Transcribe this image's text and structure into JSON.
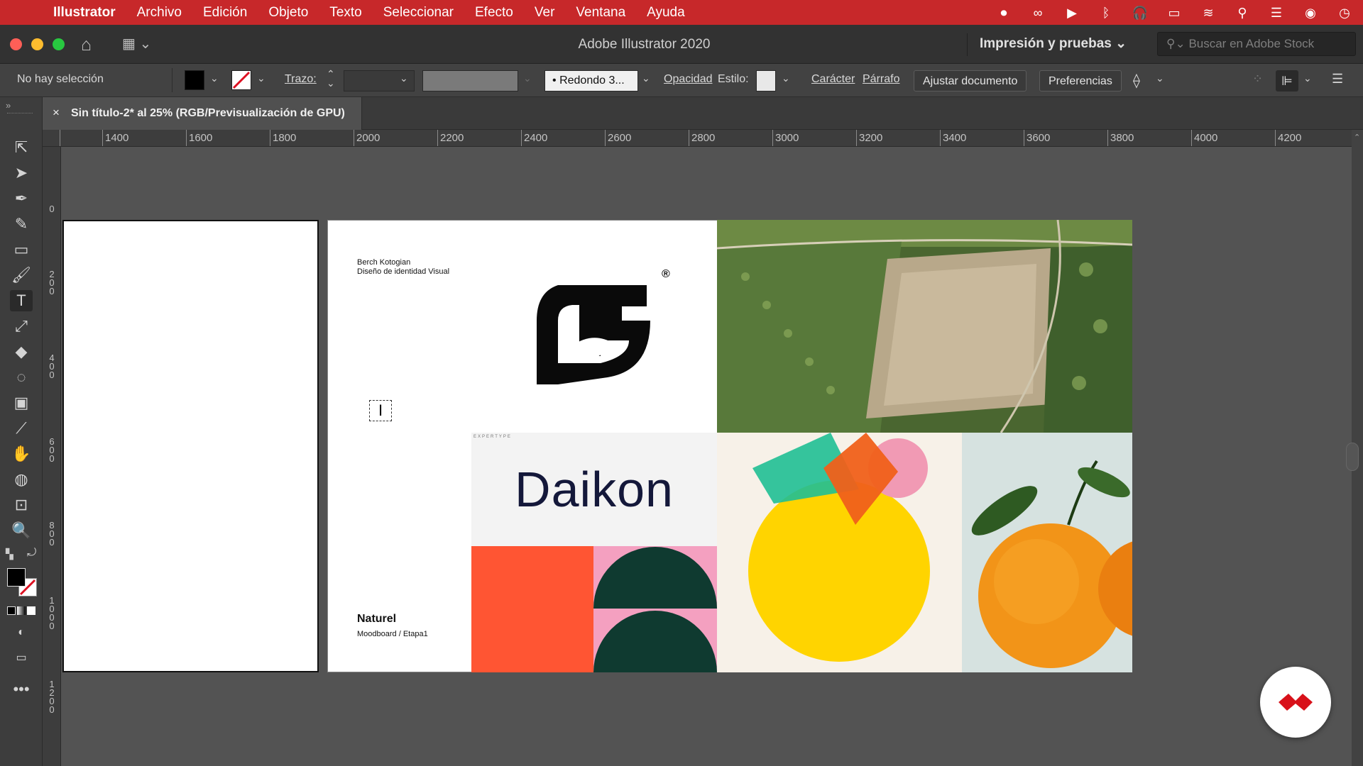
{
  "menubar": {
    "app_name": "Illustrator",
    "items": [
      "Archivo",
      "Edición",
      "Objeto",
      "Texto",
      "Seleccionar",
      "Efecto",
      "Ver",
      "Ventana",
      "Ayuda"
    ],
    "status_icons": [
      "record-icon",
      "creative-cloud-icon",
      "play-icon",
      "bluetooth-icon",
      "headphones-icon",
      "battery-icon",
      "wifi-icon",
      "search-icon",
      "control-center-icon",
      "siri-icon",
      "clock-icon"
    ]
  },
  "titlebar": {
    "title": "Adobe Illustrator 2020",
    "workspace": "Impresión y pruebas",
    "stock_search_placeholder": "Buscar en Adobe Stock"
  },
  "control_bar": {
    "selection_status": "No hay selección",
    "stroke_label": "Trazo:",
    "brush_label": "Redondo 3...",
    "opacity_label": "Opacidad",
    "style_label": "Estilo:",
    "character_label": "Carácter",
    "paragraph_label": "Párrafo",
    "fit_document_button": "Ajustar documento",
    "preferences_button": "Preferencias"
  },
  "document_tab": {
    "title": "Sin título-2* al 25% (RGB/Previsualización de GPU)"
  },
  "rulers": {
    "horizontal": [
      "1400",
      "1600",
      "1800",
      "2000",
      "2200",
      "2400",
      "2600",
      "2800",
      "3000",
      "3200",
      "3400",
      "3600",
      "3800",
      "4000",
      "4200"
    ],
    "vertical": [
      "0",
      "200",
      "400",
      "600",
      "800",
      "1000",
      "1200"
    ]
  },
  "artboard": {
    "author": "Berch Kotogian",
    "subtitle": "Diseño de identidad Visual",
    "tiny_label": "EXPERTYPE",
    "daikon_text": "Daikon",
    "project_name": "Naturel",
    "project_stage": "Moodboard / Etapa1",
    "registered_mark": "®"
  },
  "colors": {
    "menubar": "#c7282a",
    "orange_block": "#ff5533",
    "pink": "#f4a0c0",
    "dark_green": "#0f3a30",
    "yellow": "#ffd400",
    "navy": "#14183a"
  }
}
